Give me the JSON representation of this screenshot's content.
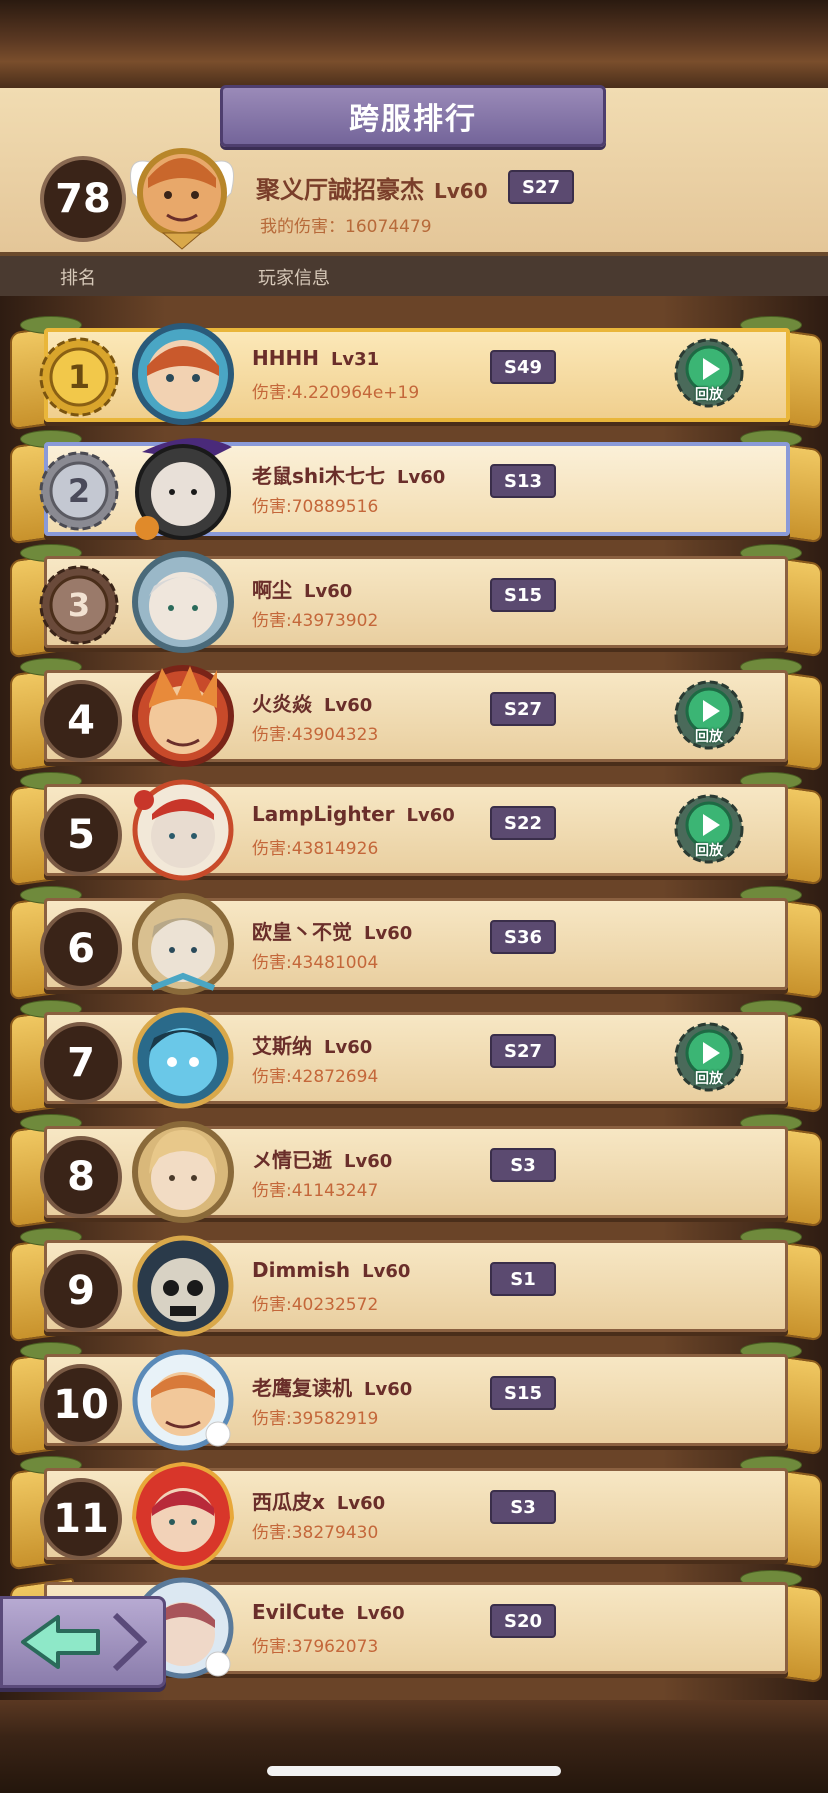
{
  "title": "跨服排行",
  "my_entry": {
    "rank": "78",
    "name": "聚义厅誠招豪杰",
    "level": "Lv60",
    "server": "S27",
    "damage": "我的伤害：16074479"
  },
  "columns": {
    "rank": "排名",
    "info": "玩家信息"
  },
  "replay_label": "回放",
  "rows": [
    {
      "rank": "1",
      "name": "HHHH",
      "level": "Lv31",
      "server": "S49",
      "damage": "伤害:4.220964e+19"
    },
    {
      "rank": "2",
      "name": "老鼠shi木七七",
      "level": "Lv60",
      "server": "S13",
      "damage": "伤害:70889516"
    },
    {
      "rank": "3",
      "name": "啊尘",
      "level": "Lv60",
      "server": "S15",
      "damage": "伤害:43973902"
    },
    {
      "rank": "4",
      "name": "火炎焱",
      "level": "Lv60",
      "server": "S27",
      "damage": "伤害:43904323"
    },
    {
      "rank": "5",
      "name": "LampLighter",
      "level": "Lv60",
      "server": "S22",
      "damage": "伤害:43814926"
    },
    {
      "rank": "6",
      "name": "欧皇丶不觉",
      "level": "Lv60",
      "server": "S36",
      "damage": "伤害:43481004"
    },
    {
      "rank": "7",
      "name": "艾斯纳",
      "level": "Lv60",
      "server": "S27",
      "damage": "伤害:42872694"
    },
    {
      "rank": "8",
      "name": "メ情已逝",
      "level": "Lv60",
      "server": "S3",
      "damage": "伤害:41143247"
    },
    {
      "rank": "9",
      "name": "Dimmish",
      "level": "Lv60",
      "server": "S1",
      "damage": "伤害:40232572"
    },
    {
      "rank": "10",
      "name": "老鹰复读机",
      "level": "Lv60",
      "server": "S15",
      "damage": "伤害:39582919"
    },
    {
      "rank": "11",
      "name": "西瓜皮x",
      "level": "Lv60",
      "server": "S3",
      "damage": "伤害:38279430"
    },
    {
      "rank": "",
      "name": "EvilCute",
      "level": "Lv60",
      "server": "S20",
      "damage": "伤害:37962073"
    }
  ],
  "icons": {
    "replay": "play-circle-icon",
    "back": "left-arrow-icon",
    "medal_gold": "gold-gear-medal-icon",
    "medal_silver": "silver-gear-medal-icon",
    "medal_bronze": "bronze-gear-medal-icon"
  },
  "colors": {
    "accent_purple": "#5b4a70",
    "gold_border": "#e9b63a",
    "silver_border": "#8a9ad8",
    "replay_green": "#3bb574"
  }
}
